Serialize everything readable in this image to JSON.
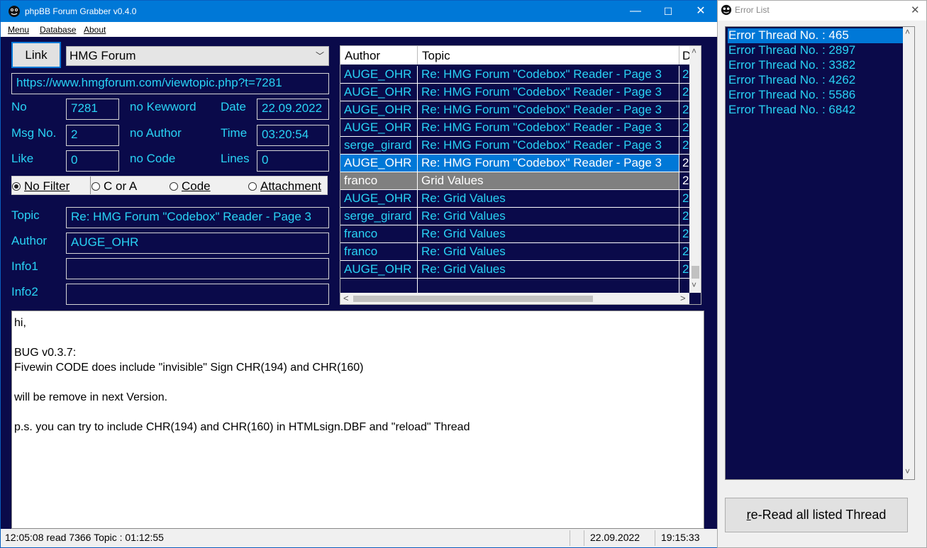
{
  "main_window": {
    "title": "phpBB Forum Grabber v0.4.0",
    "controls": {
      "minimize": "—",
      "maximize": "☐",
      "close": "✕"
    }
  },
  "menu": {
    "items": [
      {
        "label": "Menu"
      },
      {
        "label": "Database"
      },
      {
        "label": "About"
      }
    ]
  },
  "top": {
    "link_button": "Link",
    "forum_selected": "HMG Forum",
    "url": "https://www.hmgforum.com/viewtopic.php?t=7281"
  },
  "fields": {
    "no_label": "No",
    "no_value": "7281",
    "msg_no_label": "Msg No.",
    "msg_no_value": "2",
    "like_label": "Like",
    "like_value": "0",
    "no_keyword_label": "no Kewword",
    "no_author_label": "no Author",
    "no_code_label": "no Code",
    "date_label": "Date",
    "date_value": "22.09.2022",
    "time_label": "Time",
    "time_value": "03:20:54",
    "lines_label": "Lines",
    "lines_value": "0"
  },
  "filters": {
    "no_filter": "No Filter",
    "c_or_a": "C or A",
    "code": "Code",
    "attachment": "Attachment",
    "selected": "No Filter"
  },
  "details": {
    "topic_label": "Topic",
    "topic_value": "Re: HMG Forum \"Codebox\" Reader - Page 3",
    "author_label": "Author",
    "author_value": "AUGE_OHR",
    "info1_label": "Info1",
    "info1_value": "",
    "info2_label": "Info2",
    "info2_value": ""
  },
  "grid": {
    "columns": [
      "Author",
      "Topic",
      "D"
    ],
    "rows": [
      {
        "author": "AUGE_OHR",
        "topic": "Re: HMG Forum \"Codebox\" Reader - Page 3",
        "d": "2"
      },
      {
        "author": "AUGE_OHR",
        "topic": "Re: HMG Forum \"Codebox\" Reader - Page 3",
        "d": "2"
      },
      {
        "author": "AUGE_OHR",
        "topic": "Re: HMG Forum \"Codebox\" Reader - Page 3",
        "d": "2"
      },
      {
        "author": "AUGE_OHR",
        "topic": "Re: HMG Forum \"Codebox\" Reader - Page 3",
        "d": "2"
      },
      {
        "author": "serge_girard",
        "topic": "Re: HMG Forum \"Codebox\" Reader - Page 3",
        "d": "2"
      },
      {
        "author": "AUGE_OHR",
        "topic": "Re: HMG Forum \"Codebox\" Reader - Page 3",
        "d": "2"
      },
      {
        "author": "franco",
        "topic": "Grid Values",
        "d": "2"
      },
      {
        "author": "AUGE_OHR",
        "topic": "Re: Grid Values",
        "d": "2"
      },
      {
        "author": "serge_girard",
        "topic": "Re: Grid Values",
        "d": "2"
      },
      {
        "author": "franco",
        "topic": "Re: Grid Values",
        "d": "2"
      },
      {
        "author": "franco",
        "topic": "Re: Grid Values",
        "d": "2"
      },
      {
        "author": "AUGE_OHR",
        "topic": "Re: Grid Values",
        "d": "2"
      }
    ],
    "selected_row": 5,
    "highlighted_row": 6,
    "scroll": {
      "up": "˄",
      "down": "˅",
      "left": "<",
      "right": ">"
    }
  },
  "message": {
    "lines": [
      "hi,",
      "",
      "BUG  v0.3.7:",
      "Fivewin CODE does include \"invisible\" Sign CHR(194) and CHR(160)",
      "",
      "will be remove in next Version.",
      "",
      "p.s. you can try to include CHR(194) and CHR(160) in HTMLsign.DBF and \"reload\" Thread"
    ]
  },
  "status": {
    "left": "12:05:08 read 7366 Topic : 01:12:55",
    "date": "22.09.2022",
    "time": "19:15:33"
  },
  "error_window": {
    "title": "Error List",
    "close": "✕",
    "items": [
      "Error Thread No. : 465",
      "Error Thread No. : 2897",
      "Error Thread No. : 3382",
      "Error Thread No. : 4262",
      "Error Thread No. : 5586",
      "Error Thread No. : 6842"
    ],
    "selected_index": 0,
    "reread_button": "re-Read all listed Thread",
    "scroll": {
      "up": "˄",
      "down": "˅"
    }
  },
  "colors": {
    "background": "#0a0a4a",
    "text": "#29d3f5",
    "titlebar": "#0078d7",
    "selection": "#0078d7",
    "highlight": "#808080"
  }
}
